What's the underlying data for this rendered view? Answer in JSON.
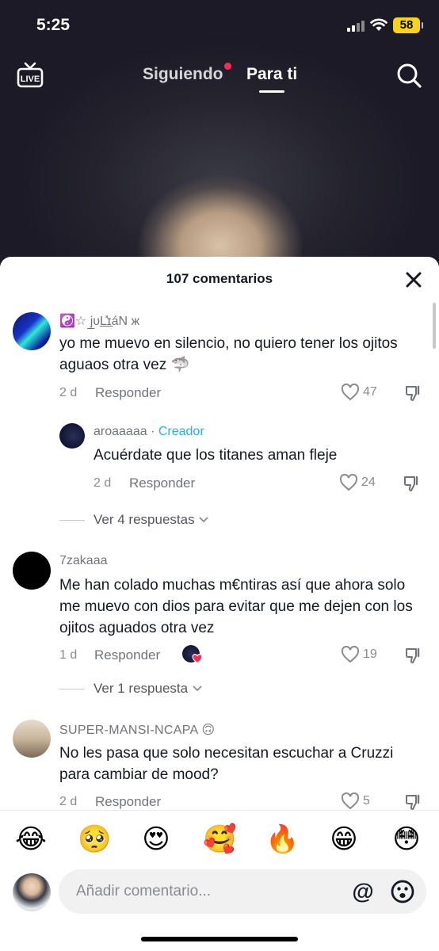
{
  "status_bar": {
    "time": "5:25",
    "battery": "58"
  },
  "top_nav": {
    "live_label": "LIVE",
    "tabs": [
      {
        "label": "Siguiendo",
        "has_notification": true
      },
      {
        "label": "Para ti",
        "active": true
      }
    ]
  },
  "comments_sheet": {
    "title": "107 comentarios",
    "comments": [
      {
        "username": "☯️☆ j̲υL̲̽ɪ̲áN ж",
        "text": "yo me muevo en silencio, no quiero tener los ojitos aguaos otra vez 🦈",
        "age": "2 d",
        "reply_label": "Responder",
        "likes": "47",
        "replies": [
          {
            "username": "aroaaaaa",
            "separator": " · ",
            "tag": "Creador",
            "text": "Acuérdate que los titanes aman fleje",
            "age": "2 d",
            "reply_label": "Responder",
            "likes": "24"
          }
        ],
        "view_replies": "Ver 4 respuestas"
      },
      {
        "username": "7zakaaa",
        "text": "Me han colado muchas m€ntiras así que ahora solo me muevo con dios para evitar que me dejen con los ojitos aguados otra vez",
        "age": "1 d",
        "reply_label": "Responder",
        "likes": "19",
        "creator_liked": true,
        "view_replies": "Ver 1 respuesta"
      },
      {
        "username": "SUPER-MANSI-NCAPA 🙃",
        "text": "No les pasa que solo necesitan escuchar a Cruzzi para cambiar de mood?",
        "age": "2 d",
        "reply_label": "Responder",
        "likes": "5"
      }
    ]
  },
  "emoji_bar": [
    "😂",
    "🥺",
    "😍",
    "🥰",
    "🔥",
    "😁",
    "😳"
  ],
  "composer": {
    "placeholder": "Añadir comentario...",
    "mention_symbol": "@"
  },
  "colors": {
    "accent_red": "#fe2c55",
    "creator_blue": "#25aef0",
    "battery": "#f7d31b"
  }
}
